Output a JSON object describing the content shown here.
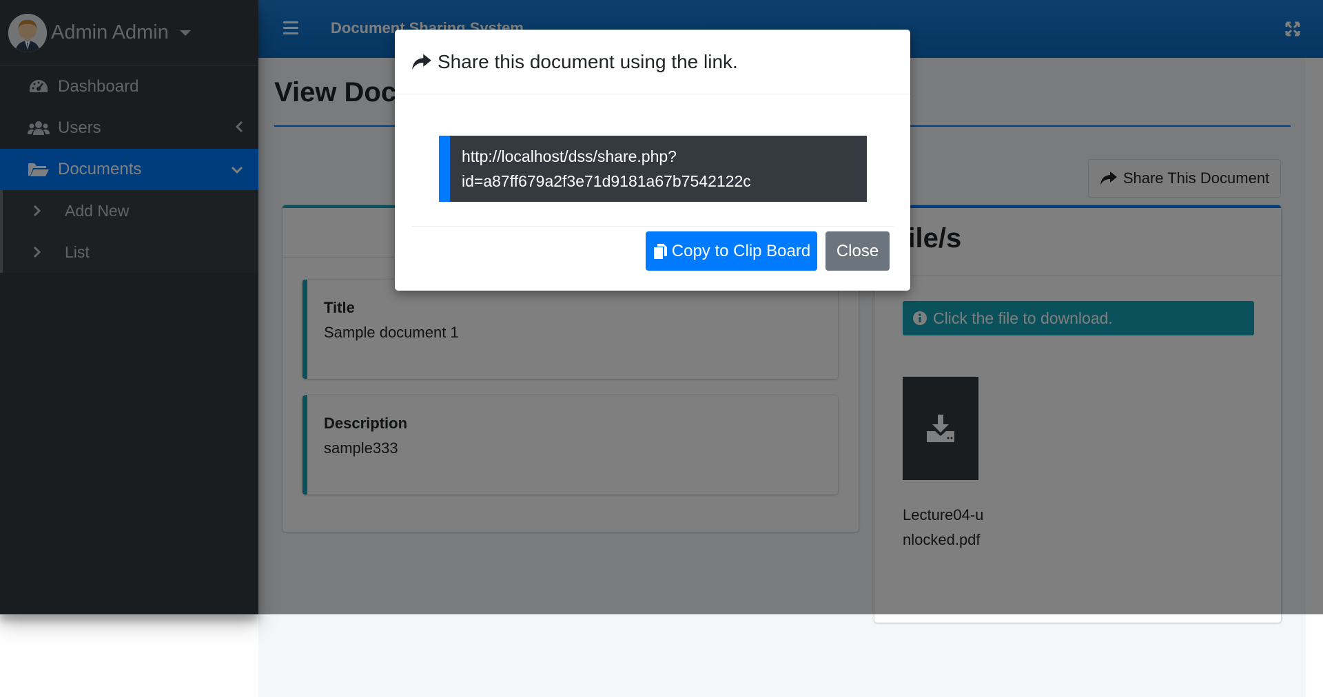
{
  "sidebar": {
    "user_name": "Admin Admin",
    "items": [
      {
        "label": "Dashboard",
        "icon": "tachometer-icon"
      },
      {
        "label": "Users",
        "icon": "users-icon"
      },
      {
        "label": "Documents",
        "icon": "folder-open-icon"
      }
    ],
    "sub_items": [
      {
        "label": "Add New"
      },
      {
        "label": "List"
      }
    ]
  },
  "header": {
    "app_title": "Document Sharing System"
  },
  "main": {
    "page_title": "View Document",
    "share_button_label": "Share This Document",
    "title_label": "Title",
    "title_value": "Sample document 1",
    "description_label": "Description",
    "description_value": "sample333",
    "files_heading": "File/s",
    "download_hint": "Click the file to download.",
    "file_name": "Lecture04-unlocked.pdf"
  },
  "modal": {
    "title": "Share this document using the link.",
    "link": "http://localhost/dss/share.php?id=a87ff679a2f3e71d9181a67b7542122c",
    "copy_label": "Copy to Clip Board",
    "close_label": "Close"
  },
  "colors": {
    "primary": "#007bff",
    "info": "#17a2b8",
    "sidebar_bg": "#343a40",
    "secondary": "#6c757d"
  }
}
